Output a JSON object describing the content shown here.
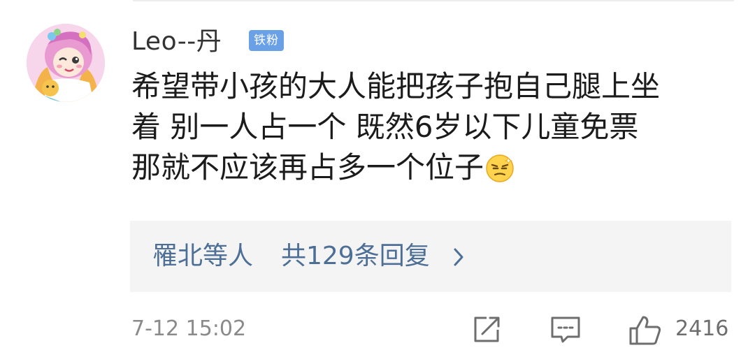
{
  "comment": {
    "username": "Leo--丹",
    "badge": "铁粉",
    "lines": [
      "希望带小孩的大人能把孩子抱自己腿上坐",
      "着 别一人占一个 既然6岁以下儿童免票",
      "那就不应该再占多一个位子"
    ],
    "emoji": "smirk-emoji",
    "replies": {
      "names": "罹北等人",
      "count_text": "共129条回复"
    },
    "timestamp": "7-12 15:02",
    "likes": "2416"
  },
  "icons": {
    "share": "share-icon",
    "reply": "comment-icon",
    "like": "thumbs-up-icon",
    "more": "chevron-right-icon"
  },
  "colors": {
    "reply_link": "#4d6f96",
    "badge_bg": "#6aa0e6",
    "timestamp": "#8a8a8a"
  }
}
